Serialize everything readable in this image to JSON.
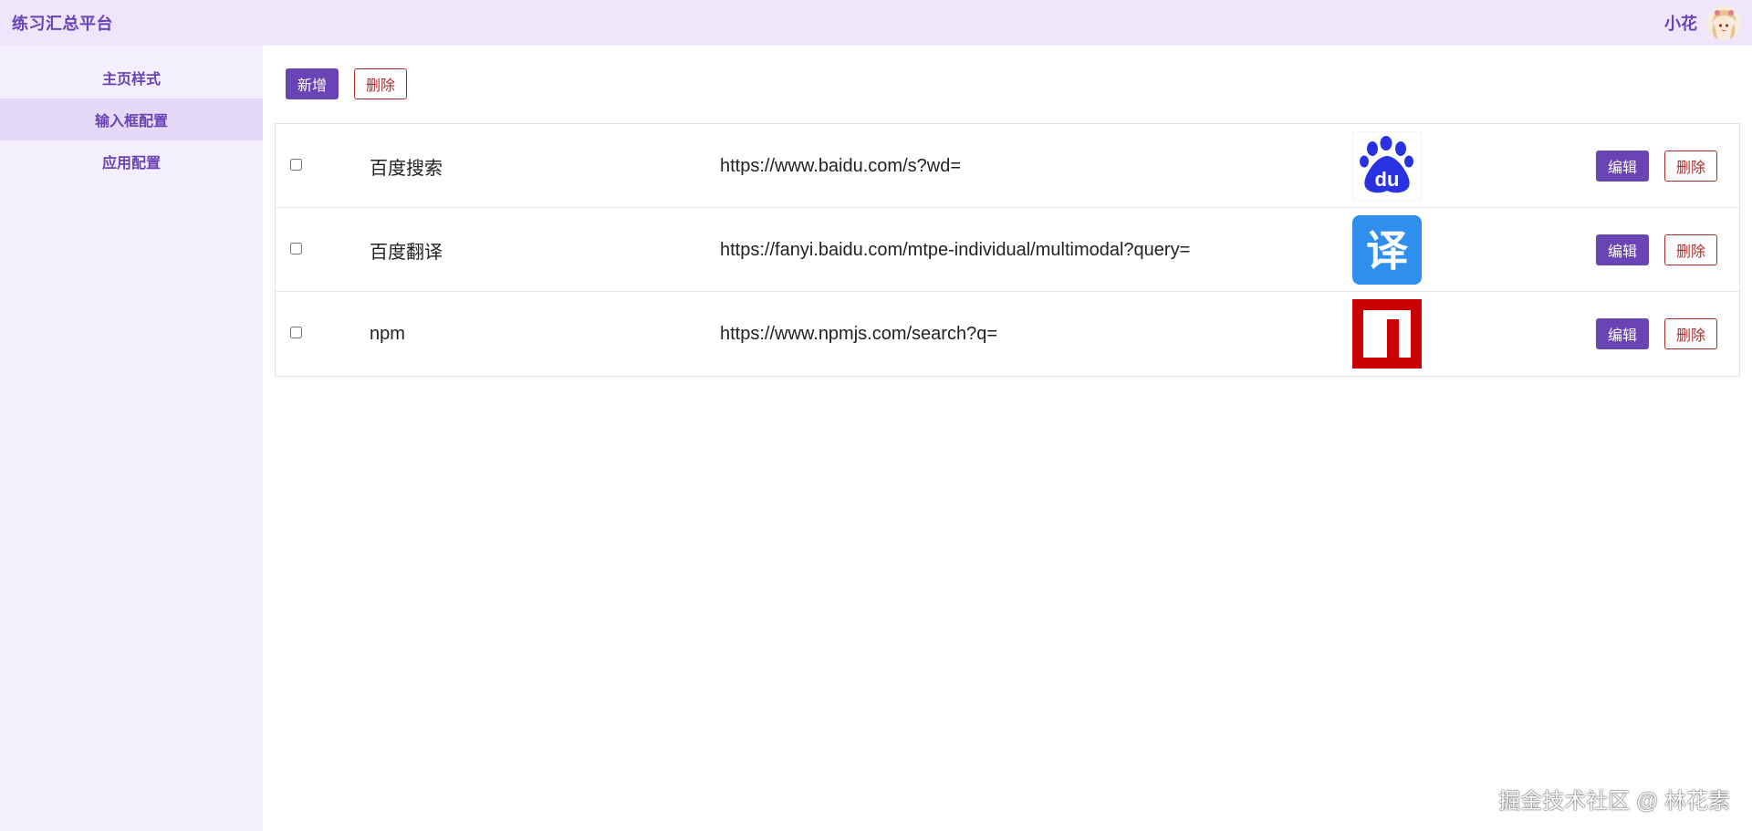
{
  "header": {
    "title": "练习汇总平台",
    "user_name": "小花"
  },
  "sidebar": {
    "items": [
      {
        "label": "主页样式",
        "active": false
      },
      {
        "label": "输入框配置",
        "active": true
      },
      {
        "label": "应用配置",
        "active": false
      }
    ]
  },
  "toolbar": {
    "add_label": "新增",
    "delete_label": "删除"
  },
  "table": {
    "rows": [
      {
        "name": "百度搜索",
        "url": "https://www.baidu.com/s?wd=",
        "icon": "baidu-logo-icon",
        "edit_label": "编辑",
        "delete_label": "删除",
        "checked": false
      },
      {
        "name": "百度翻译",
        "url": "https://fanyi.baidu.com/mtpe-individual/multimodal?query=",
        "icon": "baidu-translate-icon",
        "icon_text": "译",
        "edit_label": "编辑",
        "delete_label": "删除",
        "checked": false
      },
      {
        "name": "npm",
        "url": "https://www.npmjs.com/search?q=",
        "icon": "npm-logo-icon",
        "edit_label": "编辑",
        "delete_label": "删除",
        "checked": false
      }
    ]
  },
  "watermark": "掘金技术社区 @ 林花素",
  "colors": {
    "accent": "#6a43b5",
    "header_bg": "#efe6fb",
    "sidebar_bg": "#f4effd",
    "sidebar_active_bg": "#e4d9f7",
    "danger": "#b02a2a",
    "baidu_blue": "#2932e1",
    "translate_blue": "#2e8fef",
    "npm_red": "#cb0000"
  }
}
